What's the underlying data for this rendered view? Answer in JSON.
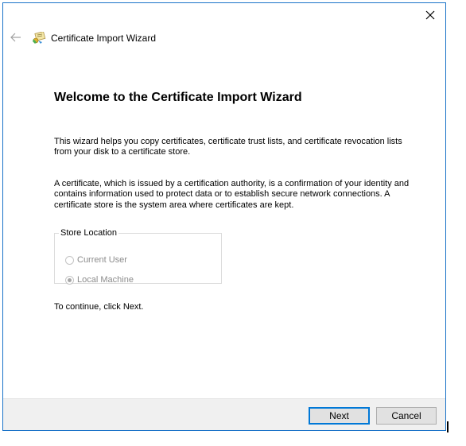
{
  "window": {
    "title": "Certificate Import Wizard",
    "close_icon": "close-icon",
    "back_icon": "arrow-left-icon",
    "wizard_icon": "certificate-icon",
    "border_color": "#1a73c8"
  },
  "content": {
    "heading": "Welcome to the Certificate Import Wizard",
    "intro": "This wizard helps you copy certificates, certificate trust lists, and certificate revocation lists from your disk to a certificate store.",
    "description": "A certificate, which is issued by a certification authority, is a confirmation of your identity and contains information used to protect data or to establish secure network connections. A certificate store is the system area where certificates are kept.",
    "store_location": {
      "legend": "Store Location",
      "options": [
        {
          "label": "Current User",
          "selected": false,
          "enabled": false
        },
        {
          "label": "Local Machine",
          "selected": true,
          "enabled": false
        }
      ]
    },
    "continue_text": "To continue, click Next."
  },
  "footer": {
    "next_label": "Next",
    "cancel_label": "Cancel",
    "background": "#f0f0f0",
    "accent": "#0078d7"
  }
}
